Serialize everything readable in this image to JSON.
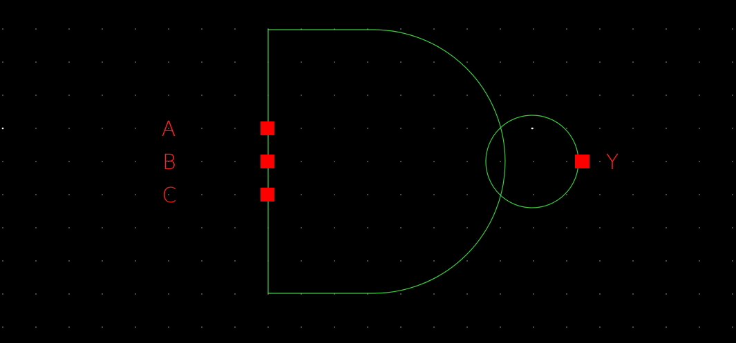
{
  "canvas": {
    "background_color": "#000000",
    "grid_dot_color": "#9a9a9a",
    "origin_marker_color": "#ffffff"
  },
  "symbol": {
    "type": "NAND3 gate",
    "body_color": "#3cd040",
    "pin_color": "#ff0000",
    "label_color": "#ff2020"
  },
  "pins": {
    "input_a": "A",
    "input_b": "B",
    "input_c": "C",
    "output_y": "Y"
  }
}
